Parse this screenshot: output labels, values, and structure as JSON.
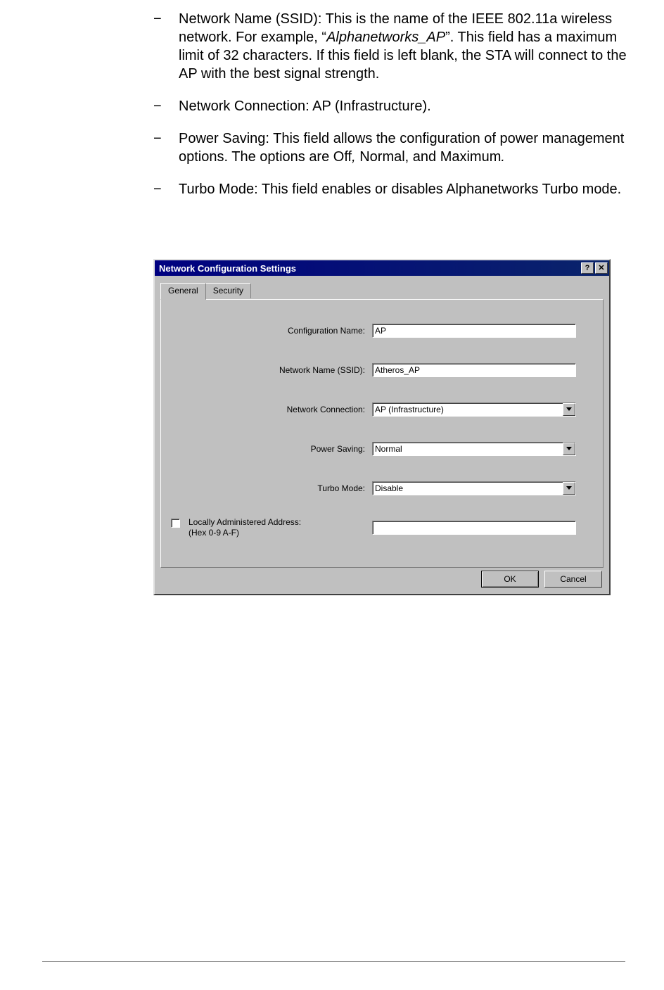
{
  "bullets": {
    "b1a": "Network Name (SSID): This is the name of the IEEE 802.11a wireless network. For example, “",
    "b1i": "Alphanetworks_AP",
    "b1b": "”. This field has a maximum limit of 32 characters. If this field is left blank, the STA will connect to the AP with the best signal strength.",
    "b2": "Network Connection: AP (Infrastructure).",
    "b3a": "Power Saving: This field allows the configuration of power management options. The options are Off",
    "b3i": ",",
    "b3b": " Normal, and Maximum",
    "b3c": ".",
    "b4": "Turbo Mode: This field enables or disables Alphanetworks Turbo mode."
  },
  "dialog": {
    "title": "Network Configuration Settings",
    "help": "?",
    "close": "✕",
    "tab_general": "General",
    "tab_security": "Security",
    "lbl_config": "Configuration Name:",
    "val_config": "AP",
    "lbl_ssid": "Network Name (SSID):",
    "val_ssid": "Atheros_AP",
    "lbl_conn": "Network Connection:",
    "val_conn": "AP (Infrastructure)",
    "lbl_power": "Power Saving:",
    "val_power": "Normal",
    "lbl_turbo": "Turbo Mode:",
    "val_turbo": "Disable",
    "lbl_laa1": "Locally Administered Address:",
    "lbl_laa2": "(Hex 0-9 A-F)",
    "btn_ok": "OK",
    "btn_cancel": "Cancel"
  }
}
